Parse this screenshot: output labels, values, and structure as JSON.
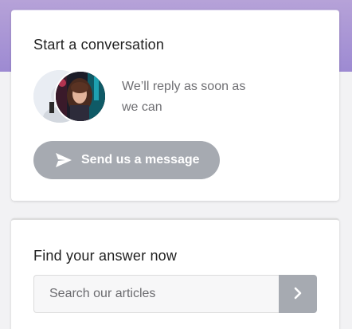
{
  "conversation": {
    "title": "Start a conversation",
    "reply_text": "We’ll reply as soon as we can",
    "send_button_label": "Send us a message",
    "send_icon": "paper-plane-icon"
  },
  "search": {
    "title": "Find your answer now",
    "placeholder": "Search our articles",
    "value": "",
    "submit_icon": "chevron-right-icon"
  },
  "colors": {
    "header_gradient_start": "#b6a2d8",
    "header_gradient_end": "#9d8ad2",
    "button_gray": "#a6aab1"
  }
}
